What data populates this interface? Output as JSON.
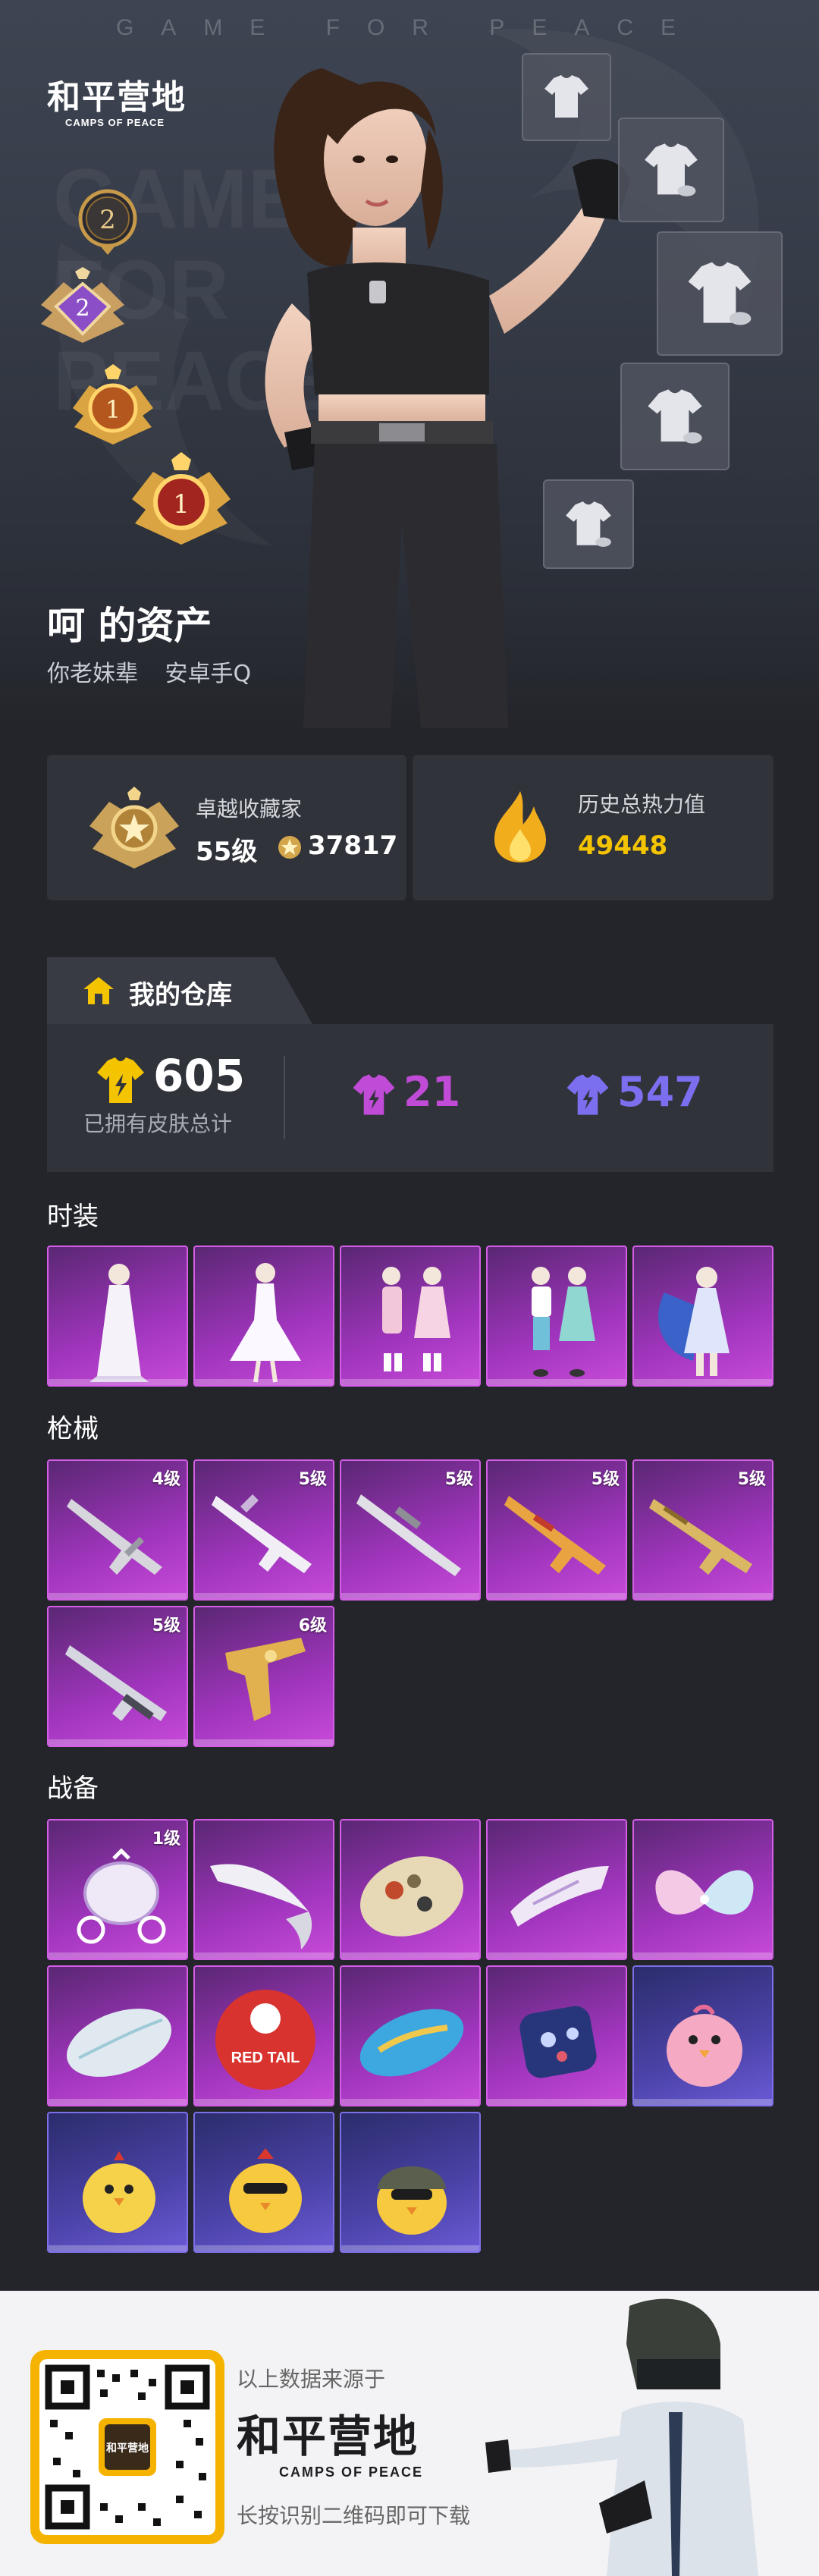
{
  "hero": {
    "tagline": "GAME FOR PEACE",
    "logo_cn": "和平营地",
    "logo_en": "CAMPS OF PEACE",
    "badges": [
      "2",
      "2",
      "1",
      "1"
    ],
    "owner_title": "呵 的资产",
    "owner_name": "你老妹辈",
    "owner_platform": "安卓手Q"
  },
  "stats": {
    "collector_label": "卓越收藏家",
    "collector_level": "55级",
    "collector_points": "37817",
    "heat_label": "历史总热力值",
    "heat_value": "49448"
  },
  "warehouse": {
    "tab_label": "我的仓库",
    "total_value": "605",
    "total_label": "已拥有皮肤总计",
    "purple_count": "21",
    "blue_count": "547",
    "colors": {
      "gold": "#f5c400",
      "purple": "#c04bd6",
      "blue": "#7b6ff0"
    }
  },
  "sections": {
    "outfits": {
      "title": "时装",
      "items": [
        {
          "icon": "white-dress-outfit-icon",
          "level": ""
        },
        {
          "icon": "white-gown-outfit-icon",
          "level": ""
        },
        {
          "icon": "pink-pair-outfit-icon",
          "level": ""
        },
        {
          "icon": "mint-pair-outfit-icon",
          "level": ""
        },
        {
          "icon": "blue-wing-outfit-icon",
          "level": ""
        }
      ]
    },
    "weapons": {
      "title": "枪械",
      "items": [
        {
          "icon": "silver-rifle-icon",
          "level": "4级"
        },
        {
          "icon": "white-rifle-icon",
          "level": "5级"
        },
        {
          "icon": "silver-sniper-icon",
          "level": "5级"
        },
        {
          "icon": "gold-rifle-icon",
          "level": "5级"
        },
        {
          "icon": "gold-assault-rifle-icon",
          "level": "5级"
        },
        {
          "icon": "purple-rifle-icon",
          "level": "5级"
        },
        {
          "icon": "gold-pistol-icon",
          "level": "6级"
        }
      ]
    },
    "gear": {
      "title": "战备",
      "items": [
        {
          "icon": "carriage-vehicle-icon",
          "level": "1级",
          "tier": "purple"
        },
        {
          "icon": "wing-glider-icon",
          "level": "",
          "tier": "purple"
        },
        {
          "icon": "camo-parachute-icon",
          "level": "",
          "tier": "purple"
        },
        {
          "icon": "white-glider-icon",
          "level": "",
          "tier": "purple"
        },
        {
          "icon": "butterfly-wing-icon",
          "level": "",
          "tier": "purple"
        },
        {
          "icon": "pearl-parachute-icon",
          "level": "",
          "tier": "purple"
        },
        {
          "icon": "red-tail-parachute-icon",
          "level": "",
          "tier": "purple",
          "text": "RED TAIL"
        },
        {
          "icon": "blue-parachute-icon",
          "level": "",
          "tier": "purple"
        },
        {
          "icon": "blue-pattern-backpack-icon",
          "level": "",
          "tier": "purple"
        },
        {
          "icon": "pink-chick-mascot-icon",
          "level": "",
          "tier": "blue"
        },
        {
          "icon": "yellow-chick-mascot-icon",
          "level": "",
          "tier": "blue"
        },
        {
          "icon": "chick-sunglasses-mascot-icon",
          "level": "",
          "tier": "blue"
        },
        {
          "icon": "chick-helmet-mascot-icon",
          "level": "",
          "tier": "blue"
        }
      ]
    }
  },
  "footer": {
    "source_text": "以上数据来源于",
    "logo_cn": "和平营地",
    "logo_en": "CAMPS OF PEACE",
    "qr_center_text": "和平营地",
    "download_text": "长按识别二维码即可下载"
  }
}
